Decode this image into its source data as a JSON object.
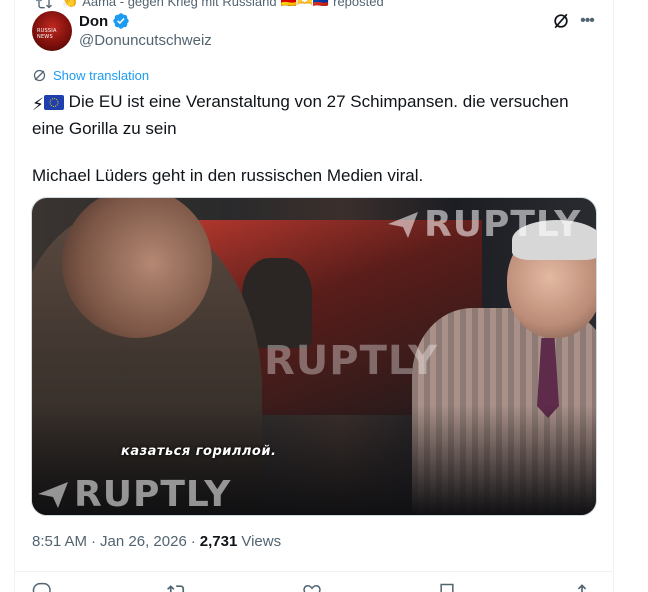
{
  "social_context": {
    "text": "Aama - gegen Krieg mit Russland",
    "suffix": "reposted"
  },
  "tweet": {
    "author": {
      "display_name": "Don",
      "handle": "@Donuncutschweiz",
      "verified": true,
      "avatar_text": "RUSSIA NEWS"
    },
    "show_translation": "Show translation",
    "text_line1": "Die EU ist eine Veranstaltung von 27 Schimpansen. die versuchen eine Gorilla zu sein",
    "text_line2": "Michael Lüders geht in den russischen Medien viral.",
    "media": {
      "watermark": "RUPTLY",
      "subtitle": "казаться гориллой."
    },
    "time": "8:51 AM",
    "separator": "·",
    "date": "Jan 26, 2026",
    "views_count": "2,731",
    "views_label": "Views"
  },
  "actions": {
    "reply_count": "",
    "repost_count": "",
    "like_count": "",
    "bookmark_count": ""
  },
  "colors": {
    "accent": "#1d9bf0",
    "secondary_text": "#536471",
    "primary_text": "#0f1419"
  }
}
